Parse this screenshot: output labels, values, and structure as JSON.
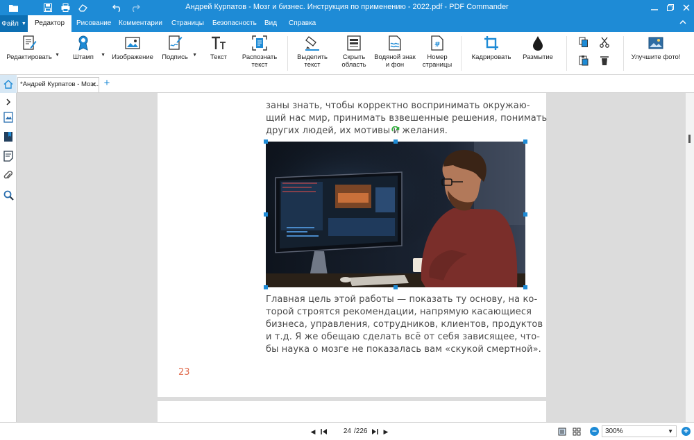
{
  "window": {
    "title": "Андрей Курпатов - Мозг и бизнес. Инструкция по применению - 2022.pdf - PDF Commander"
  },
  "quick_access": [
    "folder-icon",
    "save-icon",
    "print-icon",
    "eraser-icon",
    "undo-icon",
    "redo-icon"
  ],
  "menu": {
    "file_label": "Файл",
    "tabs": [
      "Редактор",
      "Рисование",
      "Комментарии",
      "Страницы",
      "Безопасность",
      "Вид",
      "Справка"
    ],
    "active_tab": "Редактор"
  },
  "ribbon": {
    "edit": "Редактировать",
    "stamp": "Штамп",
    "image": "Изображение",
    "signature": "Подпись",
    "text": "Текст",
    "ocr_1": "Распознать",
    "ocr_2": "текст",
    "select_1": "Выделить",
    "select_2": "текст",
    "hide_1": "Скрыть",
    "hide_2": "область",
    "watermark_1": "Водяной знак",
    "watermark_2": "и фон",
    "pagenum_1": "Номер",
    "pagenum_2": "страницы",
    "crop": "Кадрировать",
    "blur": "Размытие",
    "enhance": "Улучшите фото!"
  },
  "document_tab": {
    "label": "*Андрей Курпатов - Мозг..."
  },
  "page": {
    "para1": [
      "заны знать, чтобы корректно воспринимать окружаю-",
      "щий нас мир, принимать взвешенные решения, понимать",
      "других людей, их мотивы и желания."
    ],
    "para2": [
      "Главная цель этой работы — показать ту основу, на ко-",
      "торой строятся рекомендации, напрямую касающиеся",
      "бизнеса, управления, сотрудников, клиентов, продуктов",
      "и т.д. Я же обещаю сделать всё от себя зависящее, что-",
      "бы наука о мозге не показалась вам «скукой смертной»."
    ],
    "page_number": "23"
  },
  "statusbar": {
    "current_page": "24",
    "total_pages": "/226",
    "zoom": "300%"
  },
  "colors": {
    "accent": "#1e8bd6",
    "page_number": "#e0694a"
  }
}
